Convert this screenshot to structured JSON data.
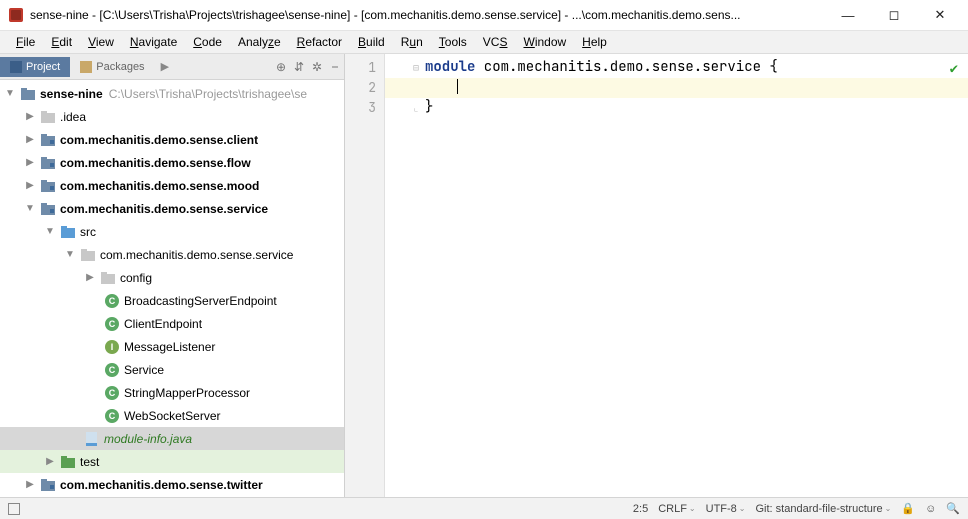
{
  "titlebar": {
    "title": "sense-nine - [C:\\Users\\Trisha\\Projects\\trishagee\\sense-nine] - [com.mechanitis.demo.sense.service] - ...\\com.mechanitis.demo.sens..."
  },
  "win": {
    "min": "—",
    "max": "◻",
    "close": "✕"
  },
  "menus": {
    "file": "File",
    "edit": "Edit",
    "view": "View",
    "navigate": "Navigate",
    "code": "Code",
    "analyze": "Analyze",
    "refactor": "Refactor",
    "build": "Build",
    "run": "Run",
    "tools": "Tools",
    "vcs": "VCS",
    "window": "Window",
    "help": "Help"
  },
  "side": {
    "project_tab": "Project",
    "packages_tab": "Packages",
    "icons": {
      "target": "⊕",
      "collapse": "⇵",
      "gear": "✲",
      "hide": "⎯"
    }
  },
  "tree": {
    "root": {
      "name": "sense-nine",
      "hint": "C:\\Users\\Trisha\\Projects\\trishagee\\se"
    },
    "idea": ".idea",
    "client": "com.mechanitis.demo.sense.client",
    "flow": "com.mechanitis.demo.sense.flow",
    "mood": "com.mechanitis.demo.sense.mood",
    "service": "com.mechanitis.demo.sense.service",
    "src": "src",
    "pkg": "com.mechanitis.demo.sense.service",
    "config": "config",
    "bse": "BroadcastingServerEndpoint",
    "ce": "ClientEndpoint",
    "ml": "MessageListener",
    "svc": "Service",
    "smp": "StringMapperProcessor",
    "wss": "WebSocketServer",
    "mi": "module-info.java",
    "test": "test",
    "twitter": "com.mechanitis.demo.sense.twitter"
  },
  "editor": {
    "lines": {
      "l1": "module com.mechanitis.demo.sense.service {",
      "l1_kw": "module",
      "l1_rest": " com.mechanitis.demo.sense.service {",
      "l3": "}"
    },
    "gutter": {
      "g1": "1",
      "g2": "2",
      "g3": "3"
    }
  },
  "status": {
    "pos": "2:5",
    "linesep": "CRLF",
    "enc": "UTF-8",
    "git": "Git: standard-file-structure"
  }
}
